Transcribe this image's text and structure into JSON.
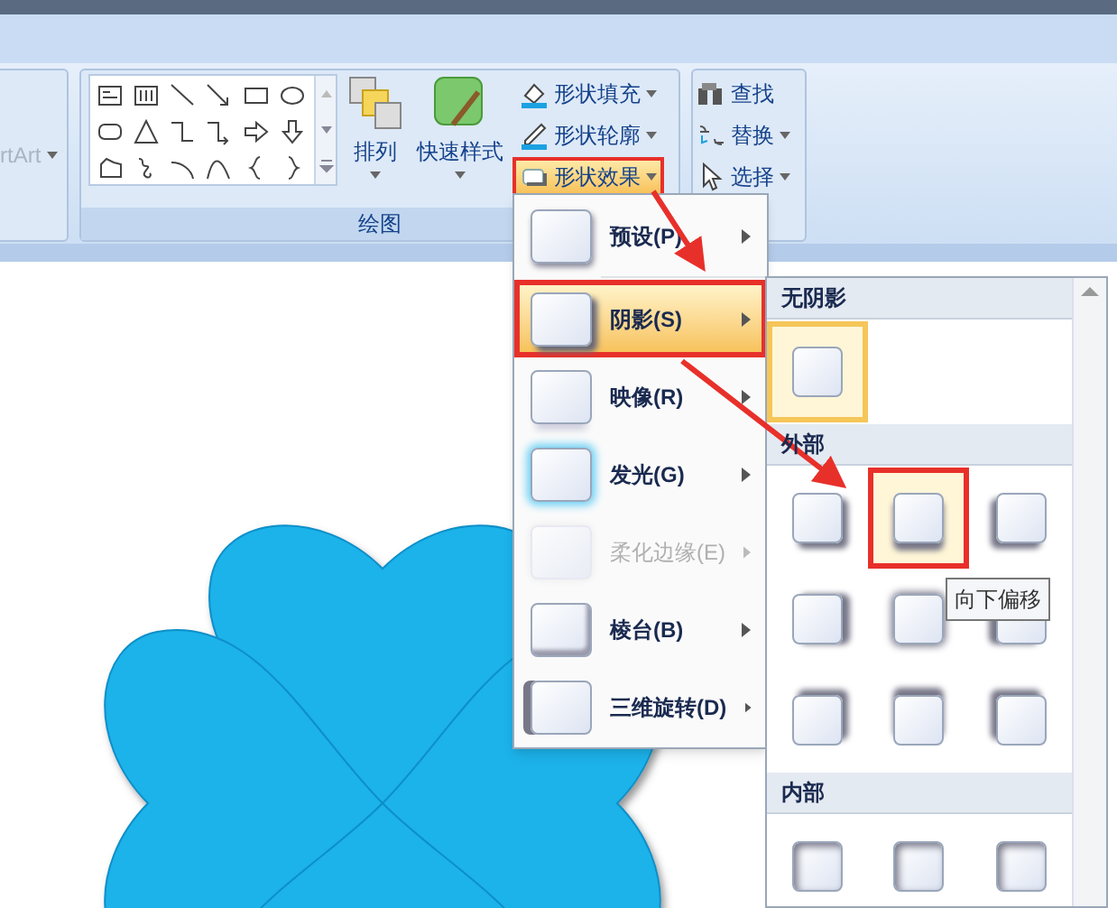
{
  "ribbon": {
    "partial_group": {
      "label": "rtArt"
    },
    "drawing_group": {
      "label": "绘图",
      "arrange": "排列",
      "quick_styles": "快速样式",
      "shape_commands": [
        {
          "kind": "fill",
          "label": "形状填充",
          "highlighted": false,
          "annotated": false
        },
        {
          "kind": "outline",
          "label": "形状轮廓",
          "highlighted": false,
          "annotated": false
        },
        {
          "kind": "effects",
          "label": "形状效果",
          "highlighted": true,
          "annotated": true
        }
      ]
    },
    "editing_group": {
      "commands": [
        {
          "kind": "find",
          "label": "查找",
          "dropdown": false
        },
        {
          "kind": "replace",
          "label": "替换",
          "dropdown": true
        },
        {
          "kind": "select",
          "label": "选择",
          "dropdown": true
        }
      ]
    }
  },
  "effects_menu": {
    "items": [
      {
        "kind": "preset",
        "label": "预设(P)",
        "selected": false,
        "disabled": false,
        "annotated": false
      },
      {
        "kind": "shadow",
        "label": "阴影(S)",
        "selected": true,
        "disabled": false,
        "annotated": true
      },
      {
        "kind": "reflection",
        "label": "映像(R)",
        "selected": false,
        "disabled": false,
        "annotated": false
      },
      {
        "kind": "glow",
        "label": "发光(G)",
        "selected": false,
        "disabled": false,
        "annotated": false
      },
      {
        "kind": "soft",
        "label": "柔化边缘(E)",
        "selected": false,
        "disabled": true,
        "annotated": false
      },
      {
        "kind": "bevel",
        "label": "棱台(B)",
        "selected": false,
        "disabled": false,
        "annotated": false
      },
      {
        "kind": "rotation",
        "label": "三维旋转(D)",
        "selected": false,
        "disabled": false,
        "annotated": false
      }
    ]
  },
  "shadow_gallery": {
    "sections": [
      {
        "title": "无阴影",
        "items": [
          {
            "kind": "none",
            "highlighted": true,
            "annotated": false
          }
        ]
      },
      {
        "title": "外部",
        "items": [
          {
            "kind": "br",
            "highlighted": false,
            "annotated": false
          },
          {
            "kind": "b",
            "highlighted": true,
            "annotated": true
          },
          {
            "kind": "bl",
            "highlighted": false,
            "annotated": false
          },
          {
            "kind": "r",
            "highlighted": false,
            "annotated": false
          },
          {
            "kind": "c",
            "highlighted": false,
            "annotated": false
          },
          {
            "kind": "l",
            "highlighted": false,
            "annotated": false
          },
          {
            "kind": "tr",
            "highlighted": false,
            "annotated": false
          },
          {
            "kind": "t",
            "highlighted": false,
            "annotated": false
          },
          {
            "kind": "tl",
            "highlighted": false,
            "annotated": false
          }
        ]
      },
      {
        "title": "内部",
        "items": [
          {
            "kind": "inner",
            "highlighted": false,
            "annotated": false
          },
          {
            "kind": "inner",
            "highlighted": false,
            "annotated": false
          },
          {
            "kind": "inner",
            "highlighted": false,
            "annotated": false
          }
        ]
      }
    ],
    "tooltip": "向下偏移"
  }
}
